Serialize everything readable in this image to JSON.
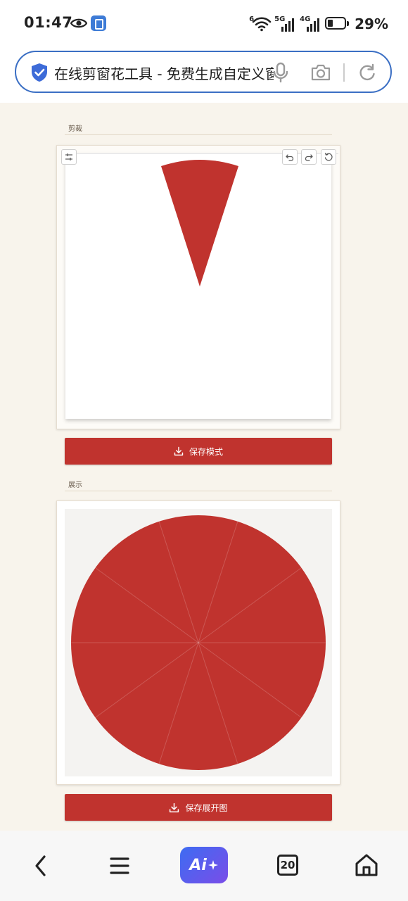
{
  "status_bar": {
    "time": "01:47",
    "wifi_tag": "6",
    "net1_tag": "5G",
    "net2_tag": "4G",
    "battery": "29%"
  },
  "browser": {
    "url_text": "在线剪窗花工具 - 免费生成自定义窗花",
    "shield_icon": "shield-check-icon",
    "mic_icon": "microphone-icon",
    "camera_icon": "camera-icon",
    "refresh_icon": "refresh-icon"
  },
  "crop_section": {
    "label": "剪裁",
    "tools_icon": "sliders-icon",
    "undo_icon": "undo-icon",
    "redo_icon": "redo-icon",
    "reset_icon": "reset-icon",
    "wedge_color": "#c0332e",
    "save_button": "保存模式"
  },
  "display_section": {
    "label": "展示",
    "circle_color": "#c0332e",
    "segments": 10,
    "save_button": "保存展开图"
  },
  "bottom_nav": {
    "back_icon": "chevron-left-icon",
    "menu_icon": "hamburger-menu-icon",
    "ai_label": "Ai",
    "tabs_count": "20",
    "home_icon": "home-icon"
  },
  "colors": {
    "accent": "#c0332e",
    "page_bg": "#f8f4ec",
    "url_border": "#3b6fc4"
  }
}
